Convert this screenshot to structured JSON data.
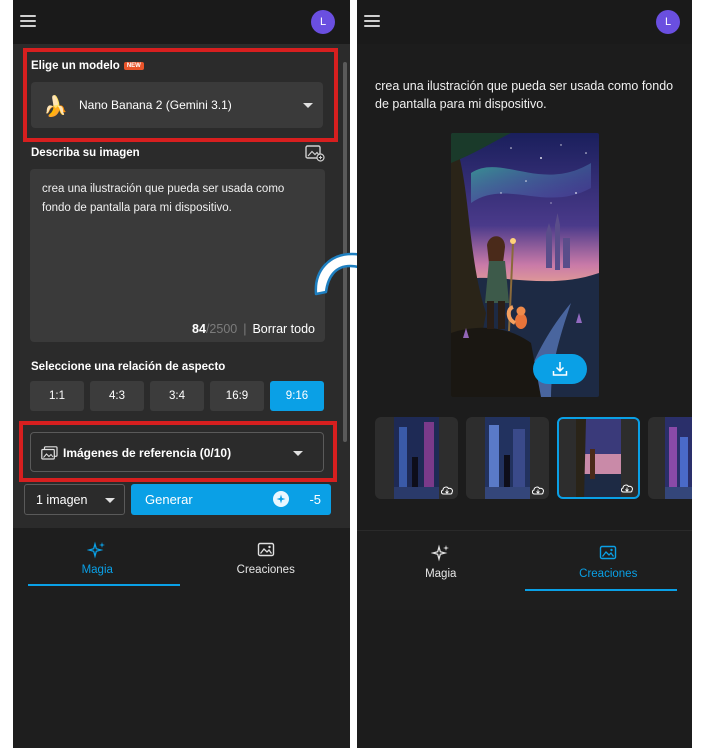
{
  "left_panel": {
    "avatar_letter": "L",
    "model_section": {
      "label": "Elige un modelo",
      "badge": "NEW",
      "selected_model": "Nano Banana 2 (Gemini 3.1)"
    },
    "prompt_section": {
      "label": "Describa su imagen",
      "text": "crea una ilustración que pueda ser usada como fondo de pantalla para mi dispositivo.",
      "char_count": "84",
      "char_max": "/2500",
      "clear_label": "Borrar todo"
    },
    "aspect_section": {
      "label": "Seleccione una relación de aspecto",
      "options": [
        "1:1",
        "4:3",
        "3:4",
        "16:9",
        "9:16"
      ],
      "selected": "9:16"
    },
    "reference_images_label": "Imágenes de referencia (0/10)",
    "quantity_value": "1 imagen",
    "generate_label": "Generar",
    "generate_cost": "-5",
    "nav": {
      "magic_label": "Magia",
      "creations_label": "Creaciones",
      "active": "Magia"
    }
  },
  "right_panel": {
    "avatar_letter": "L",
    "prompt_text": "crea una ilustración que pueda ser usada como fondo de pantalla para mi dispositivo.",
    "nav": {
      "magic_label": "Magia",
      "creations_label": "Creaciones",
      "active": "Creaciones"
    },
    "thumbnail_count_visible": 4,
    "selected_thumbnail": 3
  },
  "colors": {
    "accent": "#0aa0e6",
    "highlight_red": "#d71f1f",
    "avatar": "#6a4fe0",
    "panel_bg": "#2b2b2b"
  }
}
